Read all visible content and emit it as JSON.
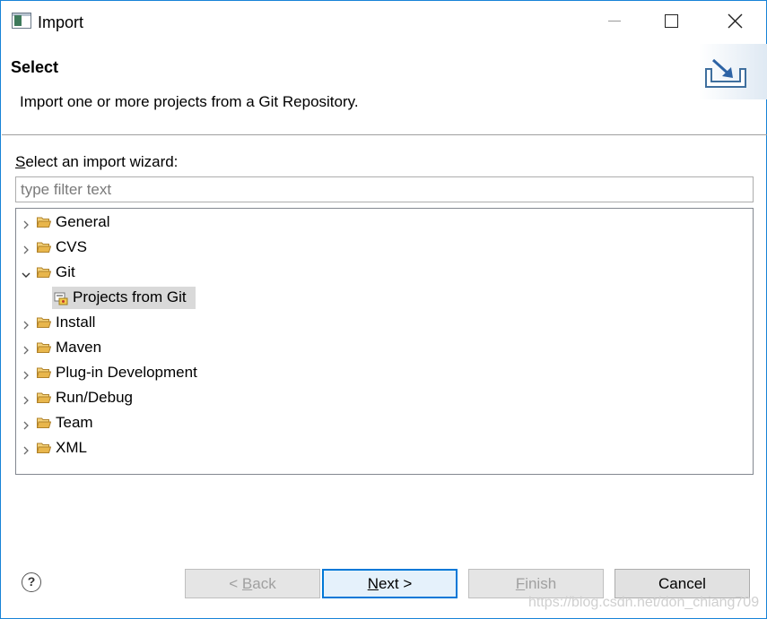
{
  "window": {
    "title": "Import"
  },
  "header": {
    "title": "Select",
    "description": "Import one or more projects from a Git Repository."
  },
  "wizard": {
    "label_first": "S",
    "label_rest": "elect an import wizard:",
    "filter_placeholder": "type filter text",
    "tree": [
      {
        "label": "General",
        "expanded": false
      },
      {
        "label": "CVS",
        "expanded": false
      },
      {
        "label": "Git",
        "expanded": true
      },
      {
        "label": "Projects from Git",
        "child": true,
        "selected": true
      },
      {
        "label": "Install",
        "expanded": false
      },
      {
        "label": "Maven",
        "expanded": false
      },
      {
        "label": "Plug-in Development",
        "expanded": false
      },
      {
        "label": "Run/Debug",
        "expanded": false
      },
      {
        "label": "Team",
        "expanded": false
      },
      {
        "label": "XML",
        "expanded": false
      }
    ]
  },
  "footer": {
    "help": "?",
    "back_pre": "< ",
    "back_key": "B",
    "back_rest": "ack",
    "next_key": "N",
    "next_rest": "ext >",
    "finish_key": "F",
    "finish_rest": "inish",
    "cancel": "Cancel"
  },
  "watermark": "https://blog.csdn.net/don_chiang709",
  "colors": {
    "accent": "#0078d7",
    "window_border": "#1883d7",
    "selection": "#d9d9d9",
    "folder": "#e8b64c"
  }
}
